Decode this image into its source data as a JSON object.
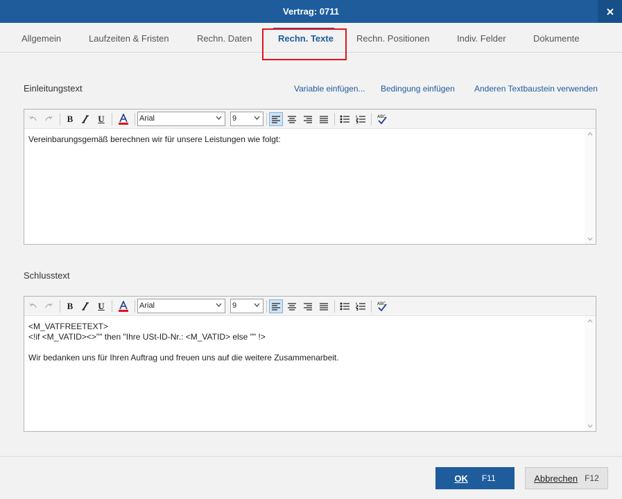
{
  "window": {
    "title": "Vertrag: 0711"
  },
  "tabs": [
    {
      "label": "Allgemein"
    },
    {
      "label": "Laufzeiten & Fristen"
    },
    {
      "label": "Rechn. Daten"
    },
    {
      "label": "Rechn. Texte"
    },
    {
      "label": "Rechn. Positionen"
    },
    {
      "label": "Indiv. Felder"
    },
    {
      "label": "Dokumente"
    }
  ],
  "active_tab": "Rechn. Texte",
  "links": {
    "variable": "Variable einfügen...",
    "condition": "Bedingung einfügen",
    "other_block": "Anderen Textbaustein verwenden"
  },
  "intro": {
    "label": "Einleitungstext",
    "font": "Arial",
    "size": "9",
    "lines": [
      "Vereinbarungsgemäß berechnen wir für unsere Leistungen wie folgt:"
    ]
  },
  "closing": {
    "label": "Schlusstext",
    "font": "Arial",
    "size": "9",
    "lines": [
      "<M_VATFREETEXT>",
      "<!if <M_VATID><>\"\" then \"Ihre USt-ID-Nr.: <M_VATID> else \"\" !>",
      "",
      "Wir bedanken uns für Ihren Auftrag und freuen uns auf die weitere Zusammenarbeit."
    ]
  },
  "footer": {
    "ok_label": "OK",
    "ok_key": "F11",
    "cancel_label": "Abbrechen",
    "cancel_key": "F12"
  },
  "colors": {
    "accent": "#1e5c9c",
    "highlight": "#e0141e"
  }
}
